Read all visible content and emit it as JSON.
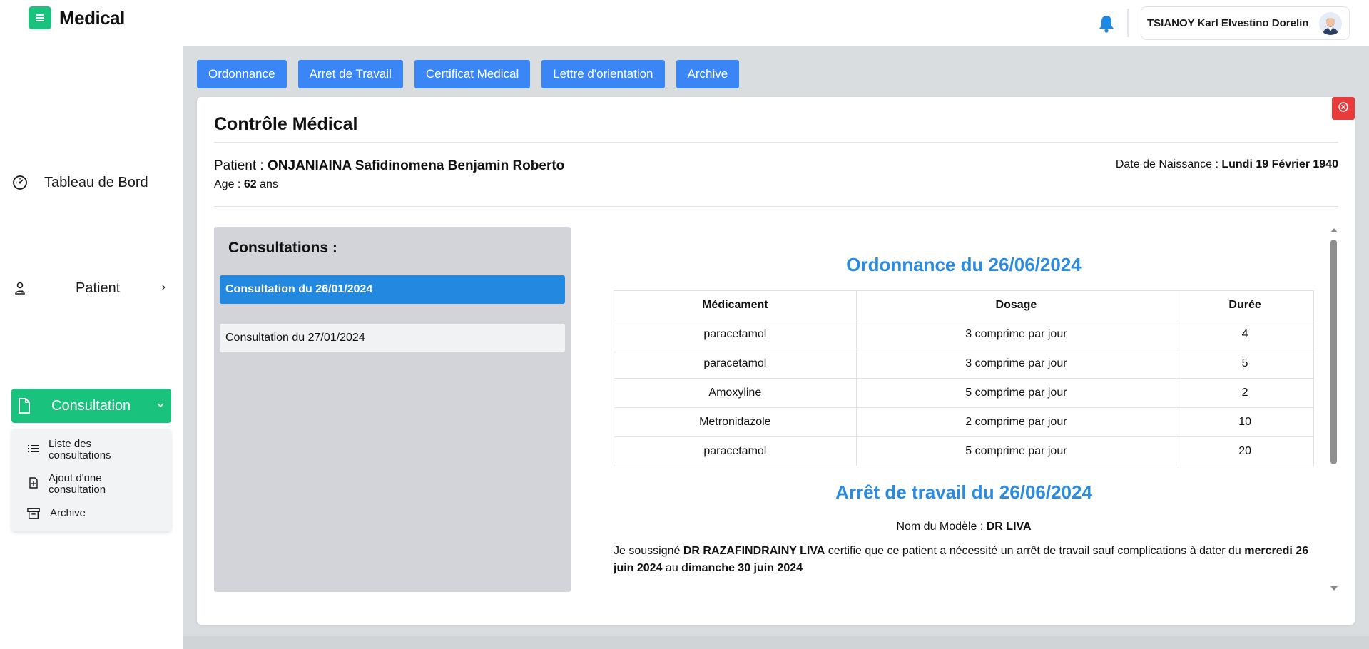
{
  "app": {
    "name": "Medical"
  },
  "user": {
    "name": "TSIANOY Karl Elvestino Dorelin"
  },
  "sidebar": {
    "items": [
      {
        "label": "Tableau de Bord"
      },
      {
        "label": "Patient"
      },
      {
        "label": "Consultation"
      }
    ],
    "submenu": [
      {
        "label": "Liste des consultations"
      },
      {
        "label": "Ajout d'une consultation"
      },
      {
        "label": "Archive"
      }
    ]
  },
  "tabs": [
    "Ordonnance",
    "Arret de Travail",
    "Certificat Medical",
    "Lettre d'orientation",
    "Archive"
  ],
  "card": {
    "title": "Contrôle Médical",
    "patient_label": "Patient : ",
    "patient_name": "ONJANIAINA Safidinomena Benjamin Roberto",
    "age_label": "Age : ",
    "age_value": "62",
    "age_unit": " ans",
    "dob_label": "Date de Naissance : ",
    "dob_value": "Lundi 19 Février 1940"
  },
  "consultations": {
    "heading": "Consultations :",
    "items": [
      {
        "label": "Consultation du 26/01/2024",
        "active": true
      },
      {
        "label": "Consultation du 27/01/2024",
        "active": false
      }
    ]
  },
  "ordonnance": {
    "title": "Ordonnance du 26/06/2024",
    "columns": [
      "Médicament",
      "Dosage",
      "Durée"
    ],
    "rows": [
      [
        "paracetamol",
        "3 comprime par jour",
        "4"
      ],
      [
        "paracetamol",
        "3 comprime par jour",
        "5"
      ],
      [
        "Amoxyline",
        "5 comprime par jour",
        "2"
      ],
      [
        "Metronidazole",
        "2 comprime par jour",
        "10"
      ],
      [
        "paracetamol",
        "5 comprime par jour",
        "20"
      ]
    ]
  },
  "arret": {
    "title": "Arrêt de travail du 26/06/2024",
    "model_label": "Nom du Modèle : ",
    "model_value": "DR LIVA",
    "text_1": "Je soussigné ",
    "doctor": "DR RAZAFINDRAINY LIVA",
    "text_2": " certifie que ce patient a nécessité un arrêt de travail sauf complications à dater du ",
    "date_from": "mercredi 26 juin 2024",
    "text_3": " au ",
    "date_to": "dimanche 30 juin 2024"
  },
  "colors": {
    "brand_green": "#19c37d",
    "tab_blue": "#3b86f7",
    "heading_blue": "#2a8be0",
    "active_item": "#2288e0",
    "close_red": "#e83c3c",
    "bell_blue": "#1e88e5"
  },
  "icons": {
    "brand": "menu-icon",
    "bell": "bell-icon",
    "dashboard": "gauge-icon",
    "patient": "user-icon",
    "consultation": "file-icon",
    "list": "list-icon",
    "add": "file-plus-icon",
    "archive": "archive-icon",
    "close": "close-circle-icon"
  }
}
